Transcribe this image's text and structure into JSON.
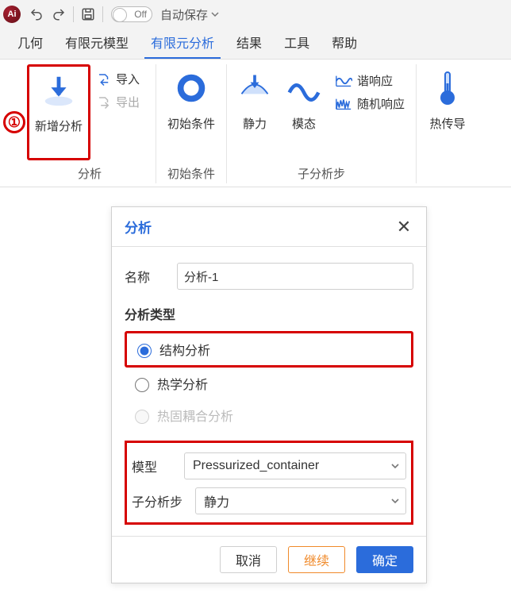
{
  "qat": {
    "autosave_toggle_text": "Off",
    "autosave_label": "自动保存"
  },
  "menubar": {
    "tabs": [
      {
        "label": "几何"
      },
      {
        "label": "有限元模型"
      },
      {
        "label": "有限元分析"
      },
      {
        "label": "结果"
      },
      {
        "label": "工具"
      },
      {
        "label": "帮助"
      }
    ],
    "active_index": 2
  },
  "ribbon": {
    "analysis_group": {
      "label": "分析",
      "new_analysis_label": "新增分析",
      "import_label": "导入",
      "export_label": "导出"
    },
    "initcond_group": {
      "label": "初始条件",
      "initcond_btn_label": "初始条件"
    },
    "substep_group": {
      "label": "子分析步",
      "static_label": "静力",
      "modal_label": "模态",
      "harmonic_label": "谐响应",
      "random_label": "随机响应"
    },
    "thermal_group": {
      "label": "",
      "thermal_btn_label": "热传导"
    },
    "annotation_number": "①"
  },
  "dialog": {
    "title": "分析",
    "name_label": "名称",
    "name_value": "分析-1",
    "analysis_type_label": "分析类型",
    "radio_options": [
      {
        "label": "结构分析",
        "value": "structural",
        "disabled": false
      },
      {
        "label": "热学分析",
        "value": "thermal",
        "disabled": false
      },
      {
        "label": "热固耦合分析",
        "value": "thermal_struct",
        "disabled": true
      }
    ],
    "radio_selected": "structural",
    "model_label": "模型",
    "model_value": "Pressurized_container",
    "substep_label": "子分析步",
    "substep_value": "静力",
    "cancel_label": "取消",
    "continue_label": "继续",
    "ok_label": "确定"
  }
}
